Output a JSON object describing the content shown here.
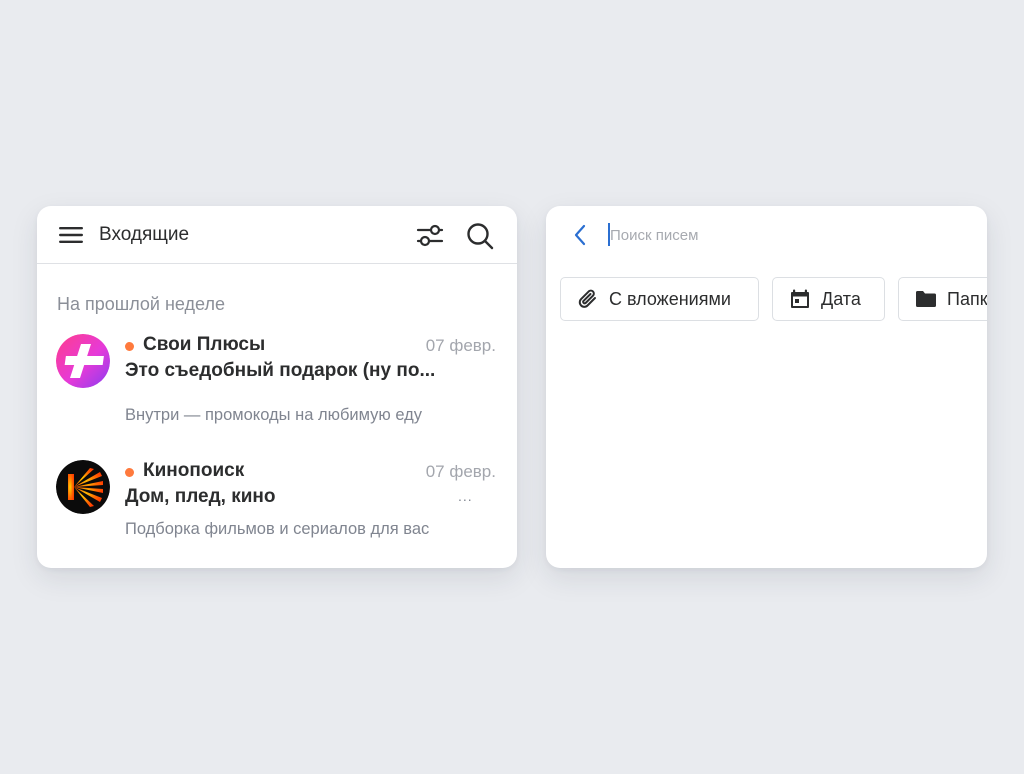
{
  "inbox": {
    "title": "Входящие",
    "section_title": "На прошлой неделе",
    "messages": [
      {
        "sender": "Свои Плюсы",
        "date": "07 февр.",
        "subject": "Это съедобный подарок (ну по...",
        "snippet": "Внутри — промокоды на любимую еду",
        "unread": true,
        "avatar_icon": "svoi-plyusy-logo-icon"
      },
      {
        "sender": "Кинопоиск",
        "date": "07 февр.",
        "subject": "Дом, плед, кино",
        "snippet": "Подборка фильмов и сериалов для вас",
        "unread": true,
        "avatar_icon": "kinopoisk-logo-icon"
      }
    ],
    "more_indicator": "..."
  },
  "search": {
    "placeholder": "Поиск писем",
    "value": "",
    "filters": [
      {
        "label": "С вложениями",
        "icon": "paperclip-icon"
      },
      {
        "label": "Дата",
        "icon": "calendar-icon"
      },
      {
        "label": "Папки",
        "icon": "folder-icon"
      }
    ]
  },
  "colors": {
    "background": "#e9ebef",
    "unread_dot": "#ff7a3d",
    "accent_blue": "#2b6fd1",
    "text_primary": "#2c2d2e",
    "text_secondary": "#808590"
  }
}
